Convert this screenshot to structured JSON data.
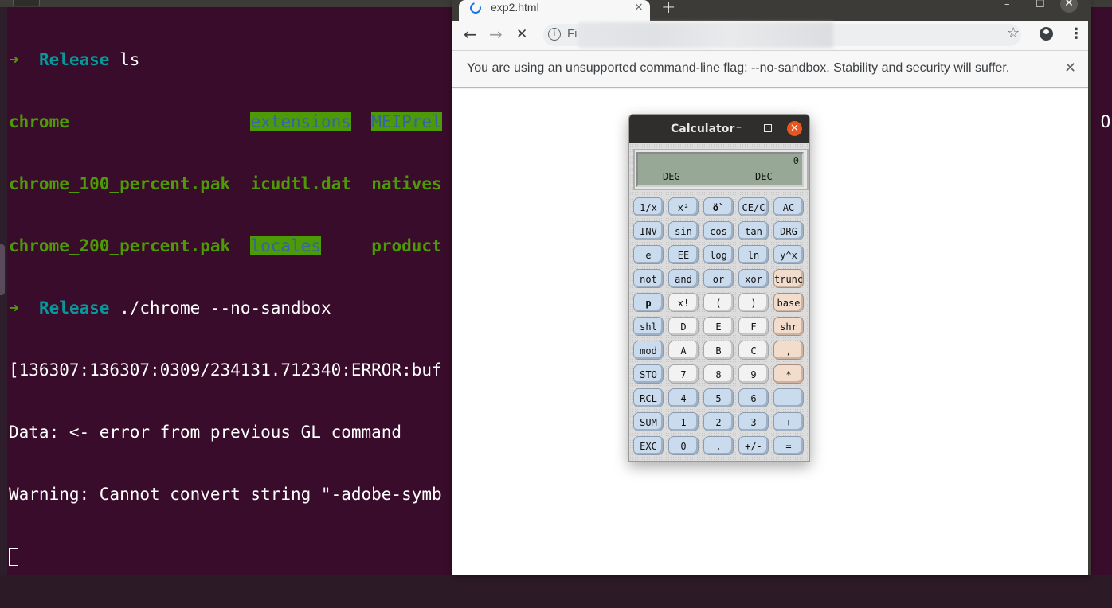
{
  "terminal": {
    "lines": [
      {
        "arrow": "➜",
        "dir": "Release",
        "cmd": " ls"
      },
      {
        "col1": "chrome                ",
        "col2": "extensions",
        "col3": "MEIPrel"
      },
      {
        "col1": "chrome_100_percent.pak",
        "col2": "icudtl.dat",
        "col3": "natives"
      },
      {
        "col1": "chrome_200_percent.pak",
        "col2": "locales",
        "col3": "product"
      },
      {
        "arrow": "➜",
        "dir": "Release",
        "cmd": " ./chrome --no-sandbox"
      },
      {
        "text": "[136307:136307:0309/234131.712340:ERROR:buf"
      },
      {
        "text": "Data: <- error from previous GL command"
      },
      {
        "text": "Warning: Cannot convert string \"-adobe-symb"
      }
    ],
    "overflow_text": "_OP"
  },
  "browser": {
    "tab": {
      "title": "exp2.html",
      "close": "×"
    },
    "new_tab": "+",
    "window_controls": {
      "minimize": "–",
      "maximize": "☐",
      "close": "✕"
    },
    "toolbar": {
      "back": "←",
      "forward": "→",
      "stop": "✕",
      "info_icon": "i",
      "address_text": "Fi",
      "star": "☆",
      "menu": "⋮"
    },
    "infobar": {
      "message": "You are using an unsupported command-line flag: --no-sandbox. Stability and security will suffer.",
      "close": "✕"
    }
  },
  "calculator": {
    "title": "Calculator",
    "controls": {
      "minimize": "–",
      "close": "✕"
    },
    "display": {
      "value": "0",
      "angle_mode": "DEG",
      "base_mode": "DEC"
    },
    "keys": [
      [
        {
          "label": "1/x",
          "style": "blue"
        },
        {
          "label": "x²",
          "style": "blue"
        },
        {
          "label": "ö`",
          "style": "blue",
          "bold": true
        },
        {
          "label": "CE/C",
          "style": "blue"
        },
        {
          "label": "AC",
          "style": "blue"
        }
      ],
      [
        {
          "label": "INV",
          "style": "blue"
        },
        {
          "label": "sin",
          "style": "blue"
        },
        {
          "label": "cos",
          "style": "blue"
        },
        {
          "label": "tan",
          "style": "blue"
        },
        {
          "label": "DRG",
          "style": "blue"
        }
      ],
      [
        {
          "label": "e",
          "style": "blue"
        },
        {
          "label": "EE",
          "style": "blue"
        },
        {
          "label": "log",
          "style": "blue"
        },
        {
          "label": "ln",
          "style": "blue"
        },
        {
          "label": "y^x",
          "style": "blue"
        }
      ],
      [
        {
          "label": "not",
          "style": "blue"
        },
        {
          "label": "and",
          "style": "blue"
        },
        {
          "label": "or",
          "style": "blue"
        },
        {
          "label": "xor",
          "style": "blue"
        },
        {
          "label": "trunc",
          "style": "peach"
        }
      ],
      [
        {
          "label": "p",
          "style": "blue",
          "bold": true
        },
        {
          "label": "x!",
          "style": "white"
        },
        {
          "label": "(",
          "style": "white"
        },
        {
          "label": ")",
          "style": "white"
        },
        {
          "label": "base",
          "style": "peach"
        }
      ],
      [
        {
          "label": "shl",
          "style": "blue"
        },
        {
          "label": "D",
          "style": "white"
        },
        {
          "label": "E",
          "style": "white"
        },
        {
          "label": "F",
          "style": "white"
        },
        {
          "label": "shr",
          "style": "peach"
        }
      ],
      [
        {
          "label": "mod",
          "style": "blue"
        },
        {
          "label": "A",
          "style": "white"
        },
        {
          "label": "B",
          "style": "white"
        },
        {
          "label": "C",
          "style": "white"
        },
        {
          "label": ",",
          "style": "peach"
        }
      ],
      [
        {
          "label": "STO",
          "style": "blue"
        },
        {
          "label": "7",
          "style": "white"
        },
        {
          "label": "8",
          "style": "white"
        },
        {
          "label": "9",
          "style": "white"
        },
        {
          "label": "*",
          "style": "peach"
        }
      ],
      [
        {
          "label": "RCL",
          "style": "blue"
        },
        {
          "label": "4",
          "style": "blue"
        },
        {
          "label": "5",
          "style": "blue"
        },
        {
          "label": "6",
          "style": "blue"
        },
        {
          "label": "-",
          "style": "blue"
        }
      ],
      [
        {
          "label": "SUM",
          "style": "blue"
        },
        {
          "label": "1",
          "style": "blue"
        },
        {
          "label": "2",
          "style": "blue"
        },
        {
          "label": "3",
          "style": "blue"
        },
        {
          "label": "+",
          "style": "blue"
        }
      ],
      [
        {
          "label": "EXC",
          "style": "blue"
        },
        {
          "label": "0",
          "style": "blue"
        },
        {
          "label": ".",
          "style": "blue"
        },
        {
          "label": "+/-",
          "style": "blue"
        },
        {
          "label": "=",
          "style": "blue"
        }
      ]
    ]
  },
  "colors": {
    "terminal_bg": "#380c2a",
    "prompt_green": "#4e9a06",
    "dir_teal": "#06989a",
    "highlight_bg": "#4e9a06",
    "highlight_fg": "#3465a4",
    "calc_close": "#e9541f",
    "calc_display": "#97a896"
  }
}
